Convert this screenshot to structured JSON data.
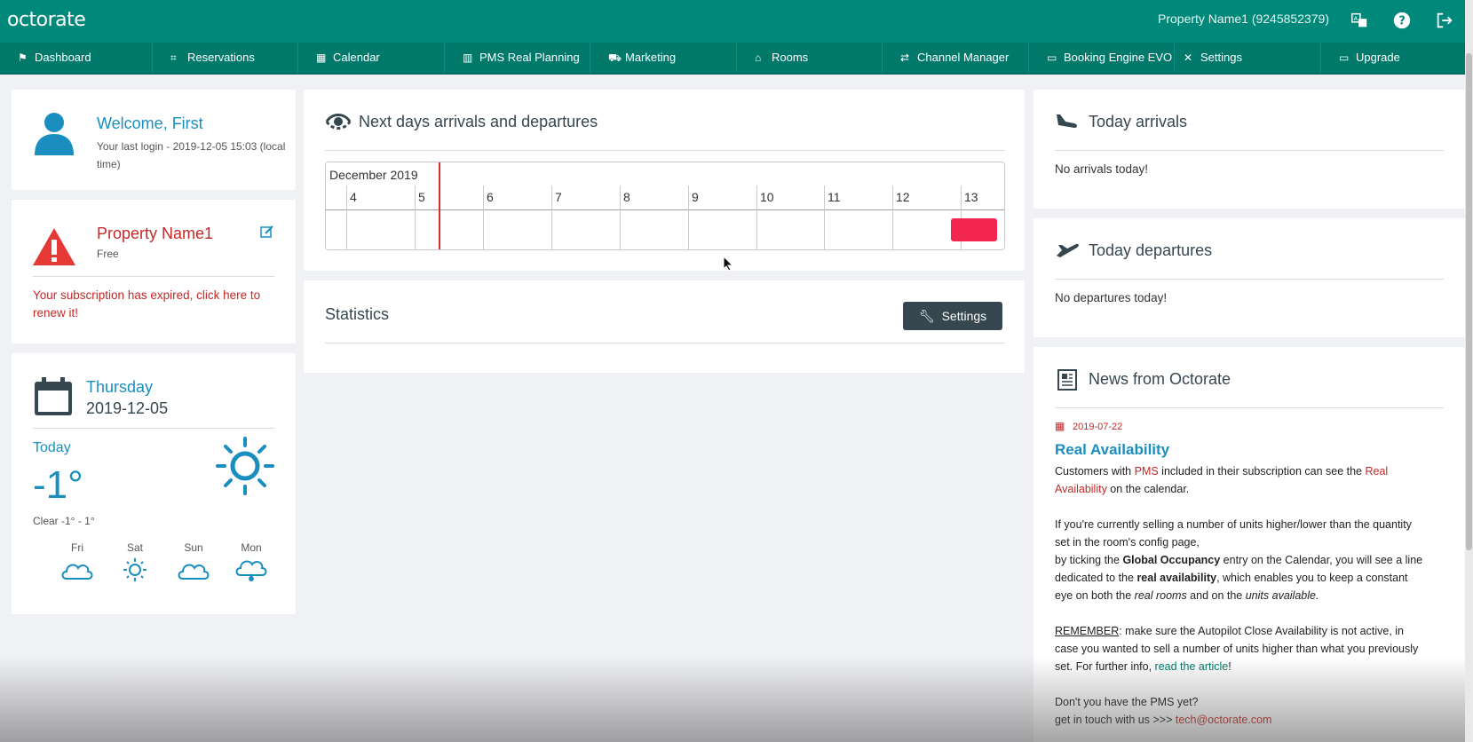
{
  "app": {
    "logo": "octorate",
    "property_label": "Property Name1 (9245852379)"
  },
  "nav": [
    {
      "label": "Dashboard",
      "icon": "flag-icon"
    },
    {
      "label": "Reservations",
      "icon": "tag-icon"
    },
    {
      "label": "Calendar",
      "icon": "calendar-icon"
    },
    {
      "label": "PMS Real Planning",
      "icon": "grid-calendar-icon"
    },
    {
      "label": "Marketing",
      "icon": "cart-icon"
    },
    {
      "label": "Rooms",
      "icon": "home-icon"
    },
    {
      "label": "Channel Manager",
      "icon": "exchange-icon"
    },
    {
      "label": "Booking Engine EVO",
      "icon": "monitor-icon"
    },
    {
      "label": "Settings",
      "icon": "tools-icon"
    },
    {
      "label": "Upgrade",
      "icon": "card-icon"
    }
  ],
  "welcome": {
    "title": "Welcome, First",
    "last_login": "Your last login - 2019-12-05 15:03 (local time)"
  },
  "property": {
    "name": "Property Name1",
    "plan": "Free",
    "expired": "Your subscription has expired, click here to renew it!"
  },
  "weather": {
    "day": "Thursday",
    "date": "2019-12-05",
    "today_label": "Today",
    "temp": "-1°",
    "condition": "Clear -1° - 1°",
    "forecast": [
      {
        "day": "Fri",
        "icon": "cloud-icon"
      },
      {
        "day": "Sat",
        "icon": "sun-icon"
      },
      {
        "day": "Sun",
        "icon": "cloud-icon"
      },
      {
        "day": "Mon",
        "icon": "rain-cloud-icon"
      }
    ]
  },
  "arrivals_departures": {
    "title": "Next days arrivals and departures",
    "month": "December 2019",
    "days": [
      "4",
      "5",
      "6",
      "7",
      "8",
      "9",
      "10",
      "11",
      "12",
      "13"
    ]
  },
  "statistics": {
    "title": "Statistics",
    "settings_label": "Settings"
  },
  "today_arrivals": {
    "title": "Today arrivals",
    "text": "No arrivals today!"
  },
  "today_departures": {
    "title": "Today departures",
    "text": "No departures today!"
  },
  "news": {
    "title": "News from Octorate",
    "date": "2019-07-22",
    "headline": "Real Availability",
    "p1_a": "Customers with ",
    "p1_pms": "PMS",
    "p1_b": " included in their subscription can see the ",
    "p1_ra": "Real Availability",
    "p1_c": " on the calendar.",
    "p2_a": "If you're currently selling a number of units higher/lower than the quantity set in the room's config page,",
    "p3_a": "by ticking the ",
    "p3_b": "Global Occupancy",
    "p3_c": " entry on the Calendar, you will see a line dedicated to the ",
    "p3_d": "real availability",
    "p3_e": ", which enables you to keep a constant eye on both the ",
    "p3_f": "real rooms",
    "p3_g": " and on the ",
    "p3_h": "units available.",
    "p4_a": "REMEMBER",
    "p4_b": ": make sure the Autopilot Close Availability is not active, in case you wanted to sell a number of units higher than what you previously set. For further info, ",
    "p4_link": "read the article",
    "p4_c": "!",
    "p5_a": "Don't you have the PMS yet?",
    "p5_b": "get in touch with us >>> ",
    "p5_email": "tech@octorate.com"
  },
  "colors": {
    "topbar": "#00897b",
    "nav": "#00796b",
    "accent_blue": "#1a8fbf",
    "alert_red": "#c62828",
    "booking": "#f2264e"
  }
}
